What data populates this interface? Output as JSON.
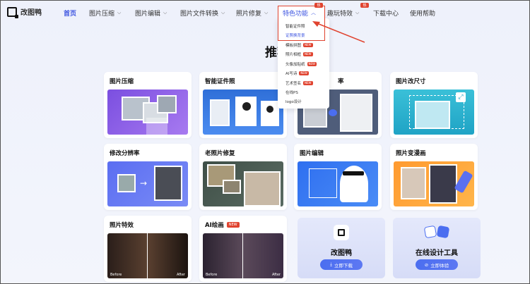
{
  "brand": {
    "name": "改图鸭"
  },
  "nav": {
    "home": "首页",
    "compress": "图片压缩",
    "edit": "图片编辑",
    "convert": "图片文件转换",
    "repair": "照片修复",
    "special": "特色功能",
    "fun": "趣玩特效",
    "download": "下载中心",
    "help": "使用帮助",
    "hot_badge": "热"
  },
  "dropdown": {
    "items": [
      {
        "label": "智能证件照"
      },
      {
        "label": "证照换背景"
      },
      {
        "label": "模板拼图",
        "badge": "NEW"
      },
      {
        "label": "照片相框",
        "badge": "NEW"
      },
      {
        "label": "头像加贴纸",
        "badge": "NEW"
      },
      {
        "label": "AI写诗",
        "badge": "NEW"
      },
      {
        "label": "艺术签名",
        "badge": "NEW"
      },
      {
        "label": "在线PS"
      },
      {
        "label": "logo设计"
      }
    ]
  },
  "section": {
    "heading": "推荐"
  },
  "cards": {
    "c1": "图片压缩",
    "c2": "智能证件照",
    "c3": "率",
    "c4": "图片改尺寸",
    "c5": "修改分辨率",
    "c6": "老照片修复",
    "c7": "图片编辑",
    "c8": "照片变漫画",
    "c9": "照片特效",
    "c10": "AI绘画",
    "c10_badge": "NEW",
    "before": "Before",
    "after": "After"
  },
  "promos": {
    "p1_title": "改图鸭",
    "p1_btn": "立即下载",
    "p2_title": "在线设计工具",
    "p2_btn": "立即体验"
  },
  "colors": {
    "accent": "#3a52e0",
    "highlight": "#e0432f"
  }
}
